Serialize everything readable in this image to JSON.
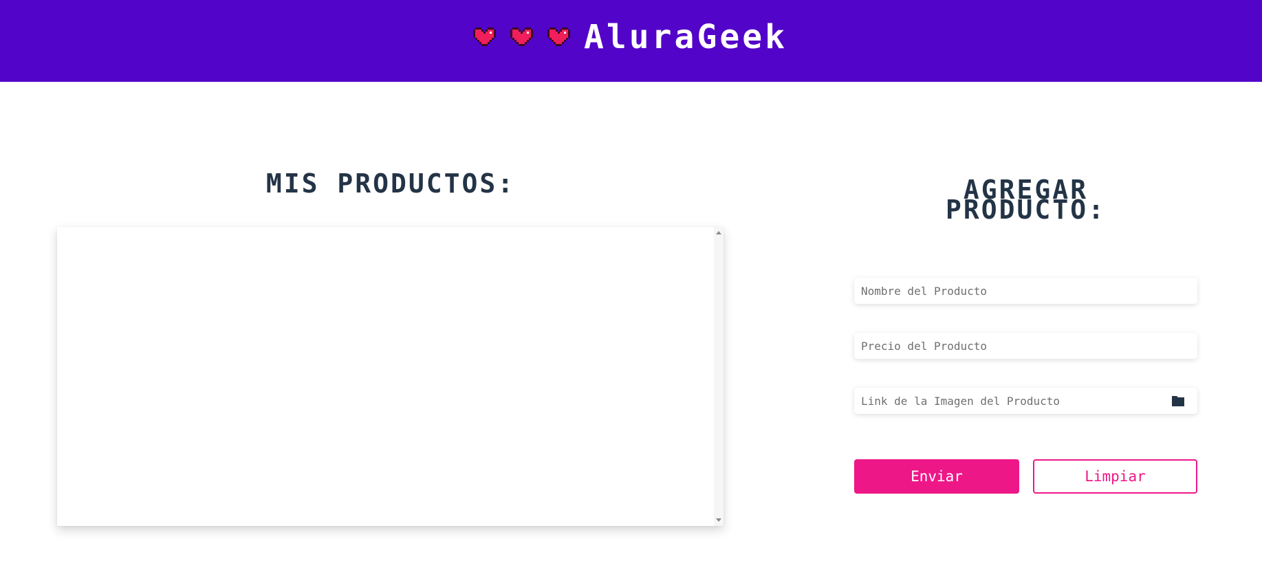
{
  "header": {
    "brand_title": "AluraGeek",
    "hearts": [
      "heart-icon",
      "heart-icon",
      "heart-icon"
    ],
    "background_color": "#5304c9"
  },
  "products_section": {
    "title": "MIS PRODUCTOS:",
    "items": []
  },
  "add_section": {
    "title_line1": "AGREGAR",
    "title_line2": "PRODUCTO:",
    "name_placeholder": "Nombre del Producto",
    "price_placeholder": "Precio del Producto",
    "image_placeholder": "Link de la Imagen del Producto",
    "image_icon": "folder-icon",
    "send_label": "Enviar",
    "clear_label": "Limpiar"
  },
  "colors": {
    "accent": "#ee1788",
    "title_text": "#243447",
    "header_bg": "#5304c9"
  }
}
